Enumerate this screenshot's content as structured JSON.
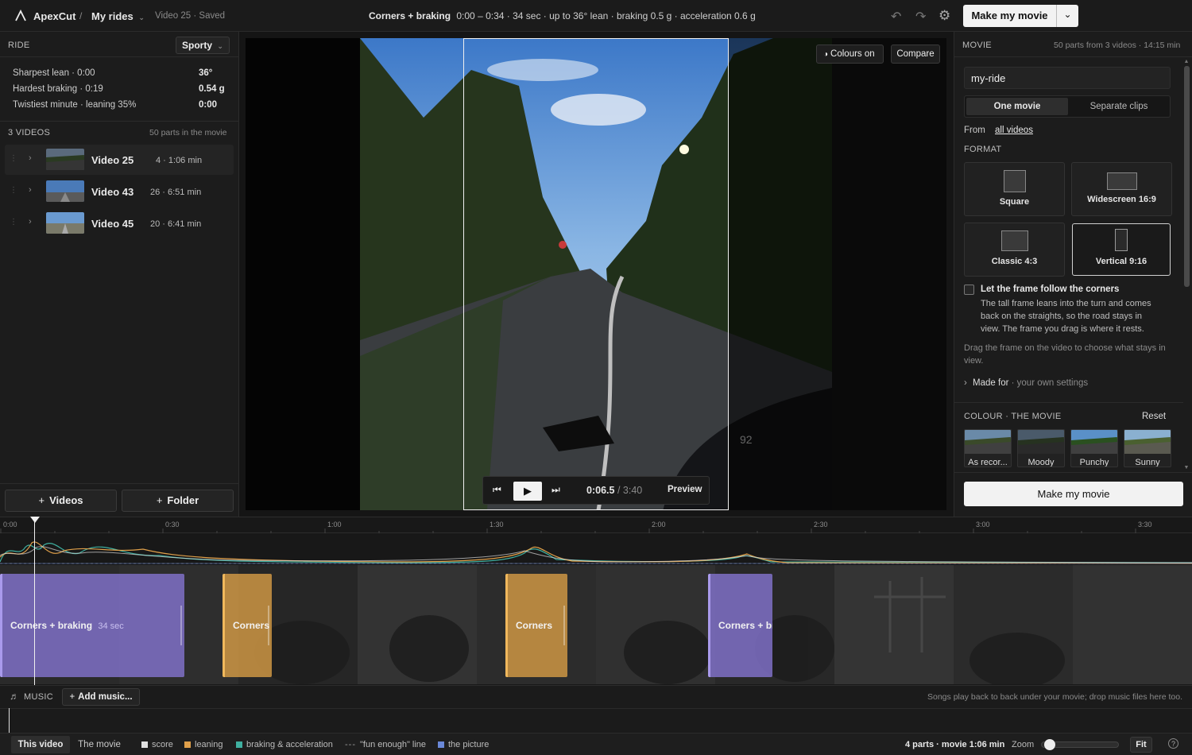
{
  "app": {
    "name": "ApexCut",
    "breadcrumb_sep": "/",
    "project": "My rides",
    "status": "Video 25 · Saved"
  },
  "header": {
    "title": "Corners + braking",
    "summary": "0:00 – 0:34 · 34 sec · up to 36° lean · braking 0.5 g · acceleration 0.6 g",
    "make_label": "Make my movie"
  },
  "ride": {
    "label": "RIDE",
    "preset": "Sporty",
    "stats": [
      {
        "label": "Sharpest lean · 0:00",
        "value": "36°"
      },
      {
        "label": "Hardest braking · 0:19",
        "value": "0.54 g"
      },
      {
        "label": "Twistiest minute · leaning 35%",
        "value": "0:00"
      }
    ]
  },
  "videos": {
    "label": "3 VIDEOS",
    "count_note": "50 parts in the movie",
    "items": [
      {
        "name": "Video 25",
        "meta": "4 · 1:06 min"
      },
      {
        "name": "Video 43",
        "meta": "26 · 6:51 min"
      },
      {
        "name": "Video 45",
        "meta": "20 · 6:41 min"
      }
    ],
    "add_videos": "Videos",
    "add_folder": "Folder"
  },
  "viewer": {
    "colours_label": "Colours on",
    "compare_label": "Compare",
    "time_current": "0:06.5",
    "time_sep": "/",
    "time_total": "3:40",
    "preview_label": "Preview",
    "speedo_text": "92"
  },
  "movie": {
    "label": "MOVIE",
    "summary": "50 parts from 3 videos · 14:15 min",
    "name_value": "my-ride",
    "modes": [
      "One movie",
      "Separate clips"
    ],
    "from_label": "From",
    "from_value": "all videos",
    "format_label": "FORMAT",
    "formats": [
      "Square",
      "Widescreen 16:9",
      "Classic 4:3",
      "Vertical 9:16"
    ],
    "selected_format": "Vertical 9:16",
    "follow_title": "Let the frame follow the corners",
    "follow_desc": "The tall frame leans into the turn and comes back on the straights, so the road stays in view. The frame you drag is where it rests.",
    "follow_checked": false,
    "drag_hint": "Drag the frame on the video to choose what stays in view.",
    "made_for_label": "Made for",
    "made_for_value": "· your own settings",
    "colour_label": "COLOUR · THE MOVIE",
    "reset_label": "Reset",
    "colours": [
      "As recor...",
      "Moody",
      "Punchy",
      "Sunny"
    ],
    "make_label": "Make my movie"
  },
  "timeline": {
    "ticks": [
      "0:00",
      "0:30",
      "1:00",
      "1:30",
      "2:00",
      "2:30",
      "3:00",
      "3:30"
    ],
    "clips": [
      {
        "title": "Corners + braking",
        "meta": "34 sec",
        "type": "purple"
      },
      {
        "title": "Corners",
        "meta": "",
        "type": "orange"
      },
      {
        "title": "Corners",
        "meta": "",
        "type": "orange"
      },
      {
        "title": "Corners + br",
        "meta": "",
        "type": "purple"
      }
    ]
  },
  "music": {
    "label": "MUSIC",
    "add_label": "Add music...",
    "hint": "Songs play back to back under your movie; drop music files here too."
  },
  "bottom": {
    "tabs": [
      "This video",
      "The movie"
    ],
    "legend": [
      {
        "label": "score",
        "color": "#e0e0e0",
        "style": "square"
      },
      {
        "label": "leaning",
        "color": "#e0a04a",
        "style": "square"
      },
      {
        "label": "braking & acceleration",
        "color": "#3fb0a0",
        "style": "square"
      },
      {
        "label": "\"fun enough\" line",
        "color": "#9a9a9a",
        "style": "dash"
      },
      {
        "label": "the picture",
        "color": "#6a88d8",
        "style": "square"
      }
    ],
    "parts_info": "4 parts · movie 1:06 min",
    "zoom_label": "Zoom",
    "zoom_value": 0.05,
    "fit_label": "Fit"
  },
  "colors": {
    "accent_purple": "#8a7ad0",
    "accent_orange": "#d89c44",
    "bg": "#1a1a1a"
  }
}
